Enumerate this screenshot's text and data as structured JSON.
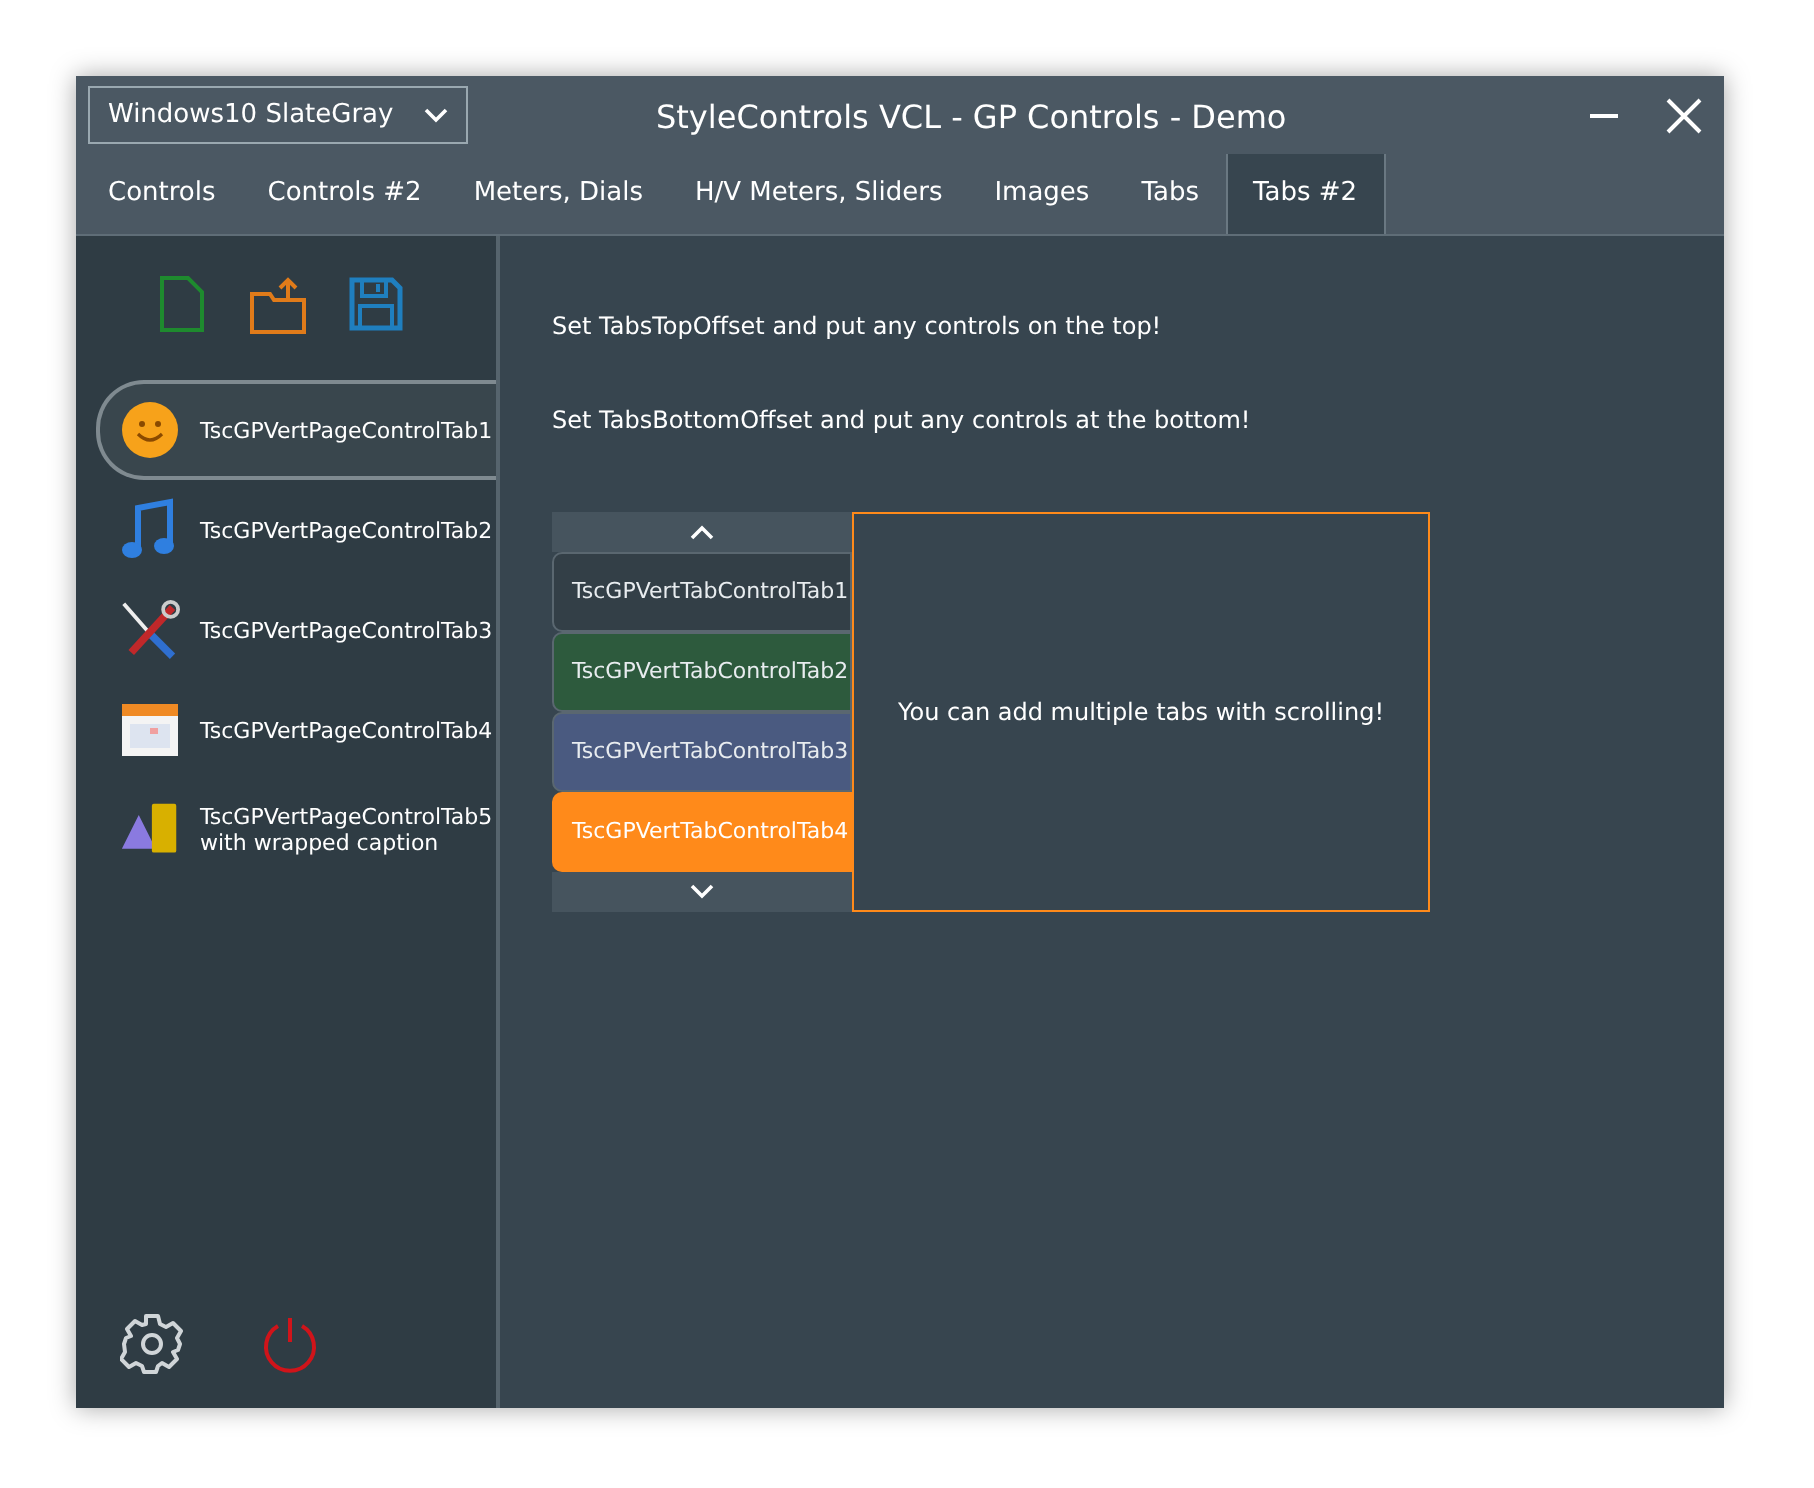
{
  "theme_select": {
    "value": "Windows10 SlateGray"
  },
  "window": {
    "title": "StyleControls VCL - GP Controls - Demo"
  },
  "tabs": [
    {
      "label": "Controls",
      "selected": false
    },
    {
      "label": "Controls #2",
      "selected": false
    },
    {
      "label": "Meters, Dials",
      "selected": false
    },
    {
      "label": "H/V Meters, Sliders",
      "selected": false
    },
    {
      "label": "Images",
      "selected": false
    },
    {
      "label": "Tabs",
      "selected": false
    },
    {
      "label": "Tabs #2",
      "selected": true
    }
  ],
  "sidebar": {
    "items": [
      {
        "label": "TscGPVertPageControlTab1",
        "kind": "smiley",
        "selected": true
      },
      {
        "label": "TscGPVertPageControlTab2",
        "kind": "music",
        "selected": false
      },
      {
        "label": "TscGPVertPageControlTab3",
        "kind": "tools",
        "selected": false
      },
      {
        "label": "TscGPVertPageControlTab4",
        "kind": "calendar",
        "selected": false
      },
      {
        "label": "TscGPVertPageControlTab5",
        "label_line_2": "with wrapped caption",
        "kind": "shapes",
        "selected": false
      }
    ]
  },
  "content": {
    "notes": [
      "Set TabsTopOffset and put any controls on the top!",
      "Set TabsBottomOffset and put any controls at the bottom!"
    ],
    "vert_tabs": [
      {
        "label": "TscGPVertTabControlTab1",
        "color": "#333f47",
        "selected": false
      },
      {
        "label": "TscGPVertTabControlTab2",
        "color": "#2d5a3d",
        "selected": false
      },
      {
        "label": "TscGPVertTabControlTab3",
        "color": "#4a5a80",
        "selected": false
      },
      {
        "label": "TscGPVertTabControlTab4",
        "color": "#ff8a1a",
        "selected": true
      }
    ],
    "panel_text": "You can add multiple tabs with scrolling!"
  }
}
